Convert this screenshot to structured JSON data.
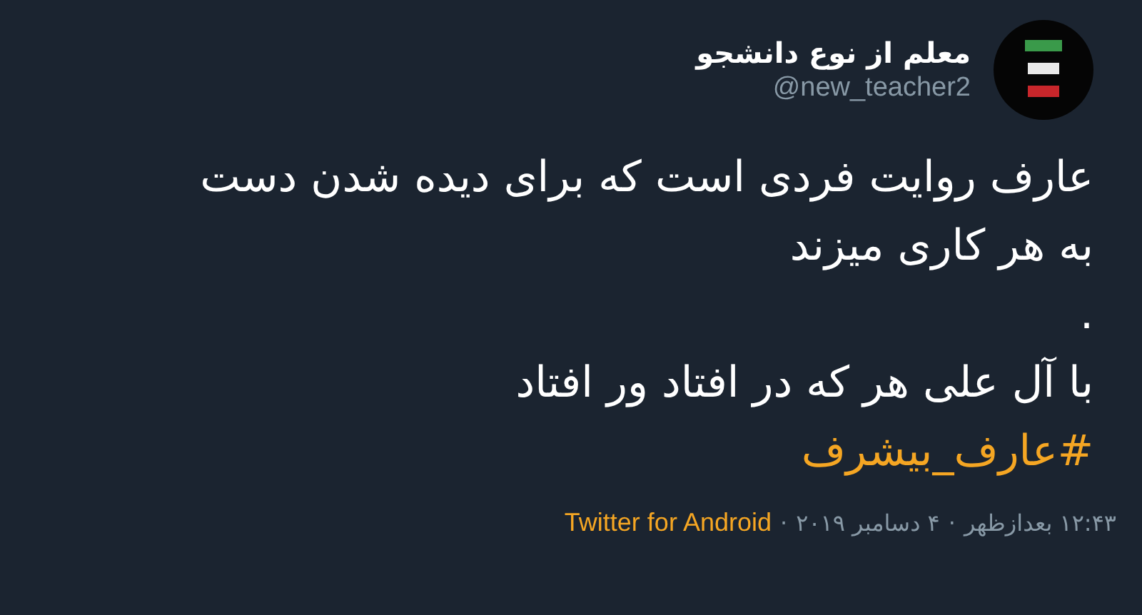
{
  "author": {
    "name": "معلم از نوع دانشجو",
    "handle": "@new_teacher2"
  },
  "tweet": {
    "lines": [
      {
        "kind": "text",
        "text": "عارف روایت فردی است که برای دیده شدن دست"
      },
      {
        "kind": "text",
        "text": "به هر کاری میزند"
      },
      {
        "kind": "text",
        "text": "."
      },
      {
        "kind": "text",
        "text": "با آل علی هر که در افتاد ور افتاد"
      },
      {
        "kind": "hashtag",
        "text": "#عارف_بیشرف"
      }
    ]
  },
  "footer": {
    "time": "۱۲:۴۳ بعدازظهر",
    "date": "۴ دسامبر ۲۰۱۹",
    "separator": "·",
    "source": "Twitter for Android"
  }
}
